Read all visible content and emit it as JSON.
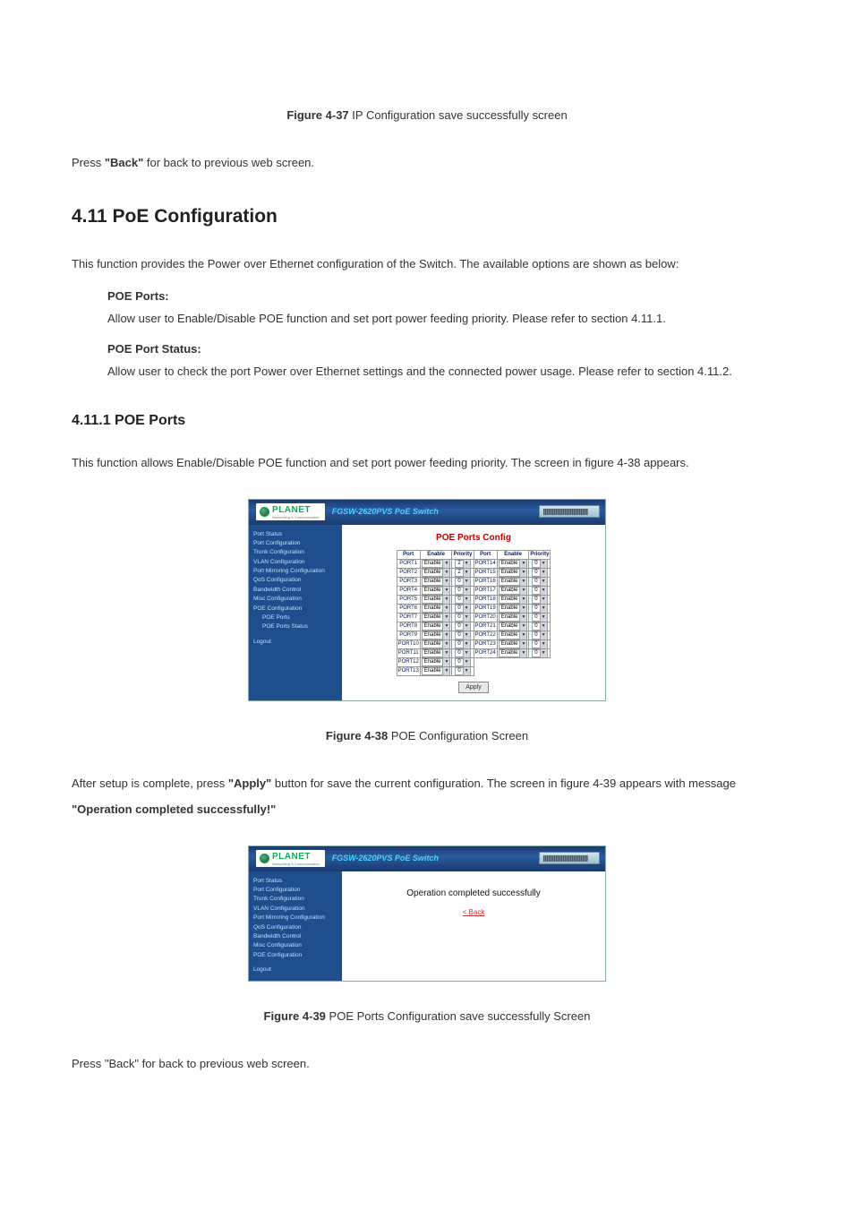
{
  "fig37": {
    "label": "Figure 4-37",
    "text": "IP Configuration save successfully screen"
  },
  "press_back_1_a": "Press ",
  "press_back_1_b": "\"Back\"",
  "press_back_1_c": " for back to previous web screen.",
  "section_title": "4.11 PoE Configuration",
  "intro": "This function provides the Power over Ethernet configuration of the Switch. The available options are shown as below:",
  "poe_ports_label": "POE Ports:",
  "poe_ports_desc": "Allow user to Enable/Disable POE function and set port power feeding priority. Please refer to section 4.11.1.",
  "poe_status_label": "POE Port Status:",
  "poe_status_desc": "Allow user to check the port Power over Ethernet settings and the connected power usage. Please refer to section 4.11.2.",
  "subsection_title": "4.11.1 POE Ports",
  "sub_intro": "This function allows Enable/Disable POE function and set port power feeding priority. The screen in figure 4-38 appears.",
  "app": {
    "logo": "PLANET",
    "logo_sub": "Networking & Communication",
    "product": "FGSW-2620PVS PoE Switch",
    "nav": [
      "Port Status",
      "Port Configuration",
      "Trunk Configuration",
      "VLAN Configuration",
      "Port Mirroring Configuration",
      "QoS Configuration",
      "Bandwidth Control",
      "Misc Configuration",
      "POE Configuration"
    ],
    "nav_sub": [
      "POE Ports",
      "POE Ports Status"
    ],
    "nav_logout": "Logout",
    "config_title": "POE Ports Config",
    "headers": {
      "port": "Port",
      "enable": "Enable",
      "priority": "Priority"
    },
    "rows_left": [
      {
        "port": "PORT1",
        "enable": "Enable",
        "priority": "2"
      },
      {
        "port": "PORT2",
        "enable": "Enable",
        "priority": "2"
      },
      {
        "port": "PORT3",
        "enable": "Enable",
        "priority": "0"
      },
      {
        "port": "PORT4",
        "enable": "Enable",
        "priority": "0"
      },
      {
        "port": "PORT5",
        "enable": "Enable",
        "priority": "0"
      },
      {
        "port": "PORT6",
        "enable": "Enable",
        "priority": "0"
      },
      {
        "port": "PORT7",
        "enable": "Enable",
        "priority": "0"
      },
      {
        "port": "PORT8",
        "enable": "Enable",
        "priority": "0"
      },
      {
        "port": "PORT9",
        "enable": "Enable",
        "priority": "0"
      },
      {
        "port": "PORT10",
        "enable": "Enable",
        "priority": "0"
      },
      {
        "port": "PORT11",
        "enable": "Enable",
        "priority": "0"
      },
      {
        "port": "PORT12",
        "enable": "Enable",
        "priority": "0"
      },
      {
        "port": "PORT13",
        "enable": "Enable",
        "priority": "0"
      }
    ],
    "rows_right": [
      {
        "port": "PORT14",
        "enable": "Enable",
        "priority": "0"
      },
      {
        "port": "PORT15",
        "enable": "Enable",
        "priority": "0"
      },
      {
        "port": "PORT16",
        "enable": "Enable",
        "priority": "0"
      },
      {
        "port": "PORT17",
        "enable": "Enable",
        "priority": "0"
      },
      {
        "port": "PORT18",
        "enable": "Enable",
        "priority": "0"
      },
      {
        "port": "PORT19",
        "enable": "Enable",
        "priority": "0"
      },
      {
        "port": "PORT20",
        "enable": "Enable",
        "priority": "0"
      },
      {
        "port": "PORT21",
        "enable": "Enable",
        "priority": "0"
      },
      {
        "port": "PORT22",
        "enable": "Enable",
        "priority": "0"
      },
      {
        "port": "PORT23",
        "enable": "Enable",
        "priority": "0"
      },
      {
        "port": "PORT24",
        "enable": "Enable",
        "priority": "0"
      }
    ],
    "apply": "Apply",
    "success": "Operation completed successfully",
    "back": "< Back"
  },
  "fig38": {
    "label": "Figure 4-38",
    "text": "POE Configuration Screen"
  },
  "after_setup_a": "After setup is complete, press ",
  "after_setup_b": "\"Apply\"",
  "after_setup_c": " button for save the current configuration. The screen in figure 4-39 appears with message ",
  "after_setup_d": "\"Operation completed successfully!\"",
  "fig39": {
    "label": "Figure 4-39",
    "text": "POE Ports Configuration save successfully Screen"
  },
  "press_back_2": "Press \"Back\" for back to previous web screen."
}
